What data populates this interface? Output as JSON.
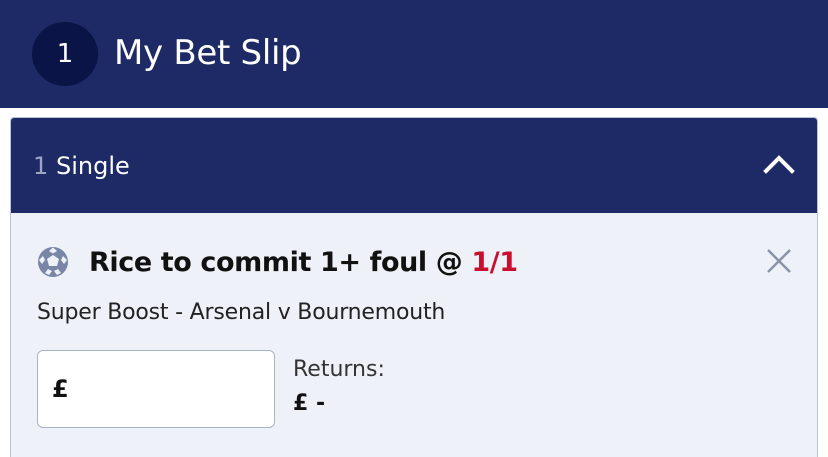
{
  "header": {
    "count": "1",
    "title": "My Bet Slip"
  },
  "bet_group": {
    "count": "1",
    "label": "Single",
    "toggle_icon": "chevron-up-icon"
  },
  "selection": {
    "icon": "football-icon",
    "name": "Rice to commit 1+ foul @ ",
    "odds": "1/1",
    "odds_color": "#c8102e",
    "market": "Super Boost - Arsenal v Bournemouth",
    "remove_icon": "close-icon"
  },
  "stake": {
    "currency": "£",
    "value": "",
    "placeholder": ""
  },
  "returns": {
    "label": "Returns:",
    "value": "£ -"
  },
  "colors": {
    "brand_navy": "#1d2a66",
    "badge_navy": "#0a1447",
    "panel_bg": "#eef2f8"
  }
}
